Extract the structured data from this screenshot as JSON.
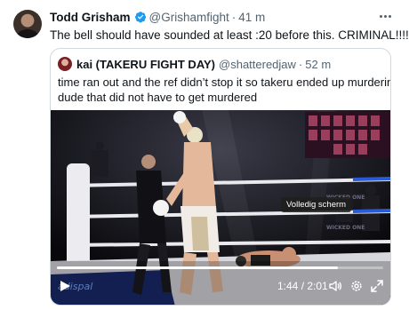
{
  "tweet": {
    "display_name": "Todd Grisham",
    "handle": "@Grishamfight",
    "separator": "·",
    "time": "41 m",
    "text": "The bell should have sounded at least :20 before this. CRIMINAL!!!!"
  },
  "quote": {
    "display_name": "kai (TAKERU FIGHT DAY)",
    "handle": "@shatteredjaw",
    "separator": "·",
    "time": "52 m",
    "text_lines": [
      "time ran out and the ref didn’t stop it so takeru ended up murdering a",
      "dude that did not have to get murdered"
    ]
  },
  "video": {
    "tooltip": "Volledig scherm",
    "current_time": "1:44",
    "time_separator": " / ",
    "duration": "2:01",
    "progress_fraction": 0.86,
    "ring_banner_text": "WICKED ONE",
    "ad_text": "adispal"
  },
  "colors": {
    "verified_blue": "#1d9bf0",
    "muted_text": "#536471",
    "border": "#cfd9de"
  },
  "icons": {
    "verified": "verified-badge-icon",
    "more": "more-horizontal-icon",
    "play": "play-icon",
    "volume": "volume-icon",
    "settings": "gear-icon",
    "fullscreen": "fullscreen-icon"
  }
}
